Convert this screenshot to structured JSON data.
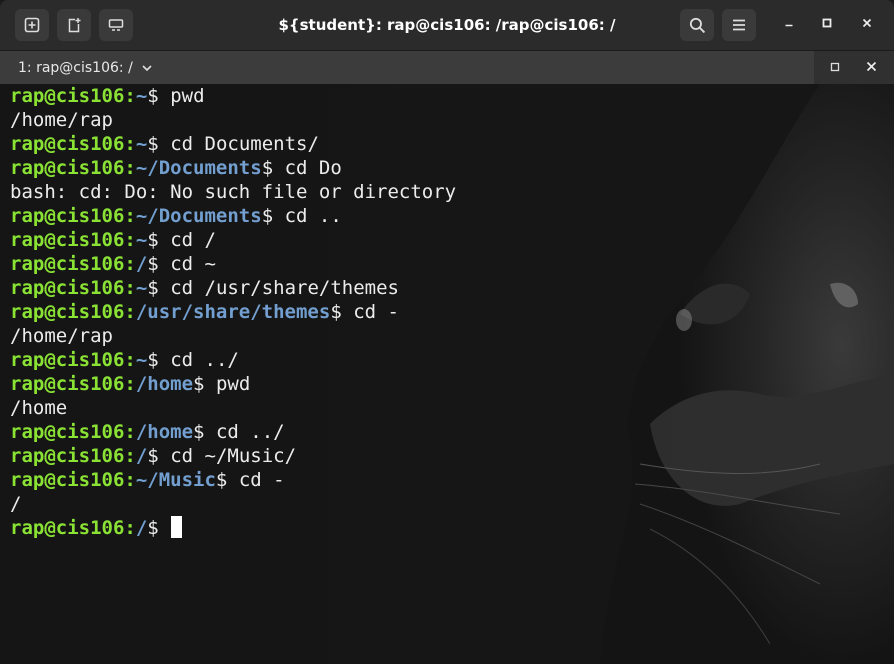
{
  "window": {
    "title": "${student}: rap@cis106: /rap@cis106: /"
  },
  "header": {
    "buttons": [
      {
        "icon": "new-tab-icon"
      },
      {
        "icon": "new-window-icon"
      },
      {
        "icon": "tab-overview-icon"
      }
    ],
    "right_buttons": [
      {
        "icon": "search-icon"
      },
      {
        "icon": "hamburger-menu-icon"
      }
    ],
    "controls": [
      {
        "icon": "minimize-icon"
      },
      {
        "icon": "maximize-icon"
      },
      {
        "icon": "close-icon"
      }
    ]
  },
  "tab": {
    "label": "1: rap@cis106: /"
  },
  "colors": {
    "prompt_user": "#8ae234",
    "prompt_path": "#729fcf",
    "text": "#ececec",
    "background": "#141414"
  },
  "terminal": {
    "prompt_user": "rap@cis106",
    "lines": [
      {
        "type": "prompt",
        "path": "~",
        "cmd": " pwd"
      },
      {
        "type": "output",
        "text": "/home/rap"
      },
      {
        "type": "prompt",
        "path": "~",
        "cmd": " cd Documents/"
      },
      {
        "type": "prompt",
        "path": "~/Documents",
        "cmd": " cd Do"
      },
      {
        "type": "output",
        "text": "bash: cd: Do: No such file or directory"
      },
      {
        "type": "prompt",
        "path": "~/Documents",
        "cmd": " cd .."
      },
      {
        "type": "prompt",
        "path": "~",
        "cmd": " cd /"
      },
      {
        "type": "prompt",
        "path": "/",
        "cmd": " cd ~"
      },
      {
        "type": "prompt",
        "path": "~",
        "cmd": " cd /usr/share/themes"
      },
      {
        "type": "prompt",
        "path": "/usr/share/themes",
        "cmd": " cd -"
      },
      {
        "type": "output",
        "text": "/home/rap"
      },
      {
        "type": "prompt",
        "path": "~",
        "cmd": " cd ../"
      },
      {
        "type": "prompt",
        "path": "/home",
        "cmd": " pwd"
      },
      {
        "type": "output",
        "text": "/home"
      },
      {
        "type": "prompt",
        "path": "/home",
        "cmd": " cd ../"
      },
      {
        "type": "prompt",
        "path": "/",
        "cmd": " cd ~/Music/"
      },
      {
        "type": "prompt",
        "path": "~/Music",
        "cmd": " cd -"
      },
      {
        "type": "output",
        "text": "/"
      },
      {
        "type": "prompt",
        "path": "/",
        "cmd": " ",
        "cursor": true
      }
    ]
  }
}
